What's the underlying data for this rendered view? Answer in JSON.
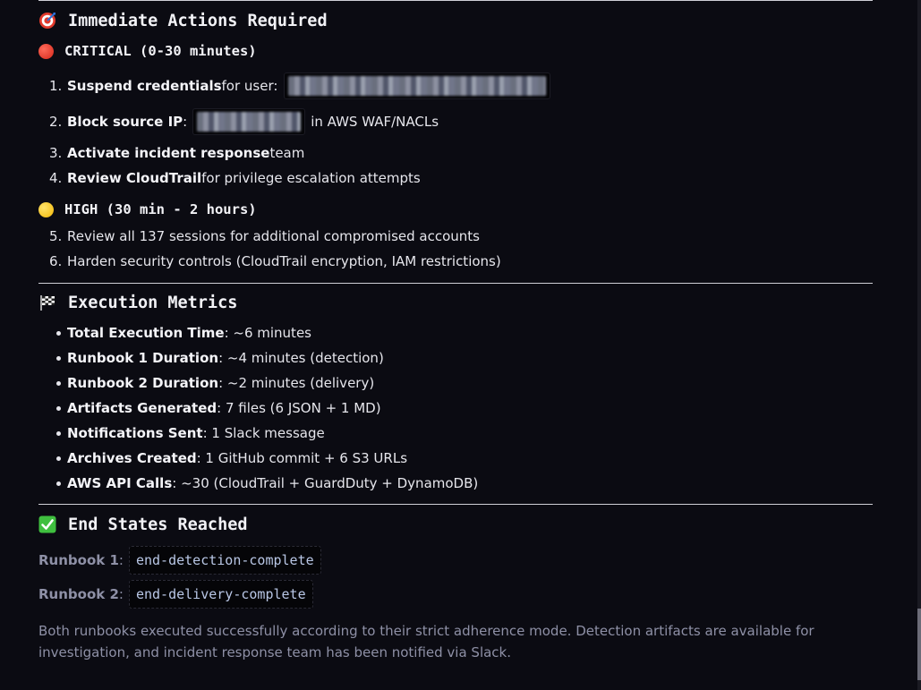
{
  "immediate": {
    "title": "Immediate Actions Required",
    "critical": {
      "title": "CRITICAL (0-30 minutes)",
      "items": [
        {
          "num": "1.",
          "bold": "Suspend credentials",
          "rest": " for user:"
        },
        {
          "num": "2.",
          "bold": "Block source IP",
          "rest": ":",
          "after": " in AWS WAF/NACLs"
        },
        {
          "num": "3.",
          "bold": "Activate incident response",
          "rest": " team"
        },
        {
          "num": "4.",
          "bold": "Review CloudTrail",
          "rest": " for privilege escalation attempts"
        }
      ]
    },
    "high": {
      "title": "HIGH (30 min - 2 hours)",
      "items": [
        {
          "num": "5.",
          "text": "Review all 137 sessions for additional compromised accounts"
        },
        {
          "num": "6.",
          "text": "Harden security controls (CloudTrail encryption, IAM restrictions)"
        }
      ]
    }
  },
  "metrics": {
    "title": "Execution Metrics",
    "items": [
      {
        "bold": "Total Execution Time",
        "rest": ": ~6 minutes"
      },
      {
        "bold": "Runbook 1 Duration",
        "rest": ": ~4 minutes (detection)"
      },
      {
        "bold": "Runbook 2 Duration",
        "rest": ": ~2 minutes (delivery)"
      },
      {
        "bold": "Artifacts Generated",
        "rest": ": 7 files (6 JSON + 1 MD)"
      },
      {
        "bold": "Notifications Sent",
        "rest": ": 1 Slack message"
      },
      {
        "bold": "Archives Created",
        "rest": ": 1 GitHub commit + 6 S3 URLs"
      },
      {
        "bold": "AWS API Calls",
        "rest": ": ~30 (CloudTrail + GuardDuty + DynamoDB)"
      }
    ]
  },
  "end_states": {
    "title": "End States Reached",
    "rows": [
      {
        "label": "Runbook 1",
        "colon": ":",
        "code": "end-detection-complete"
      },
      {
        "label": "Runbook 2",
        "colon": ":",
        "code": "end-delivery-complete"
      }
    ],
    "note": "Both runbooks executed successfully according to their strict adherence mode. Detection artifacts are available for investigation, and incident response team has been notified via Slack."
  },
  "icons": {
    "target": "target-icon",
    "checkered_flag": "checkered-flag-icon",
    "check": "check-mark-icon",
    "red_circle": "red-circle-icon",
    "yellow_circle": "yellow-circle-icon"
  },
  "colors": {
    "background": "#0b0b12",
    "text": "#e8e8ee",
    "muted": "#8e90a6",
    "code": "#b9c7e6",
    "critical": "#e0311f",
    "high": "#f2b705",
    "success": "#3fbf3f"
  }
}
